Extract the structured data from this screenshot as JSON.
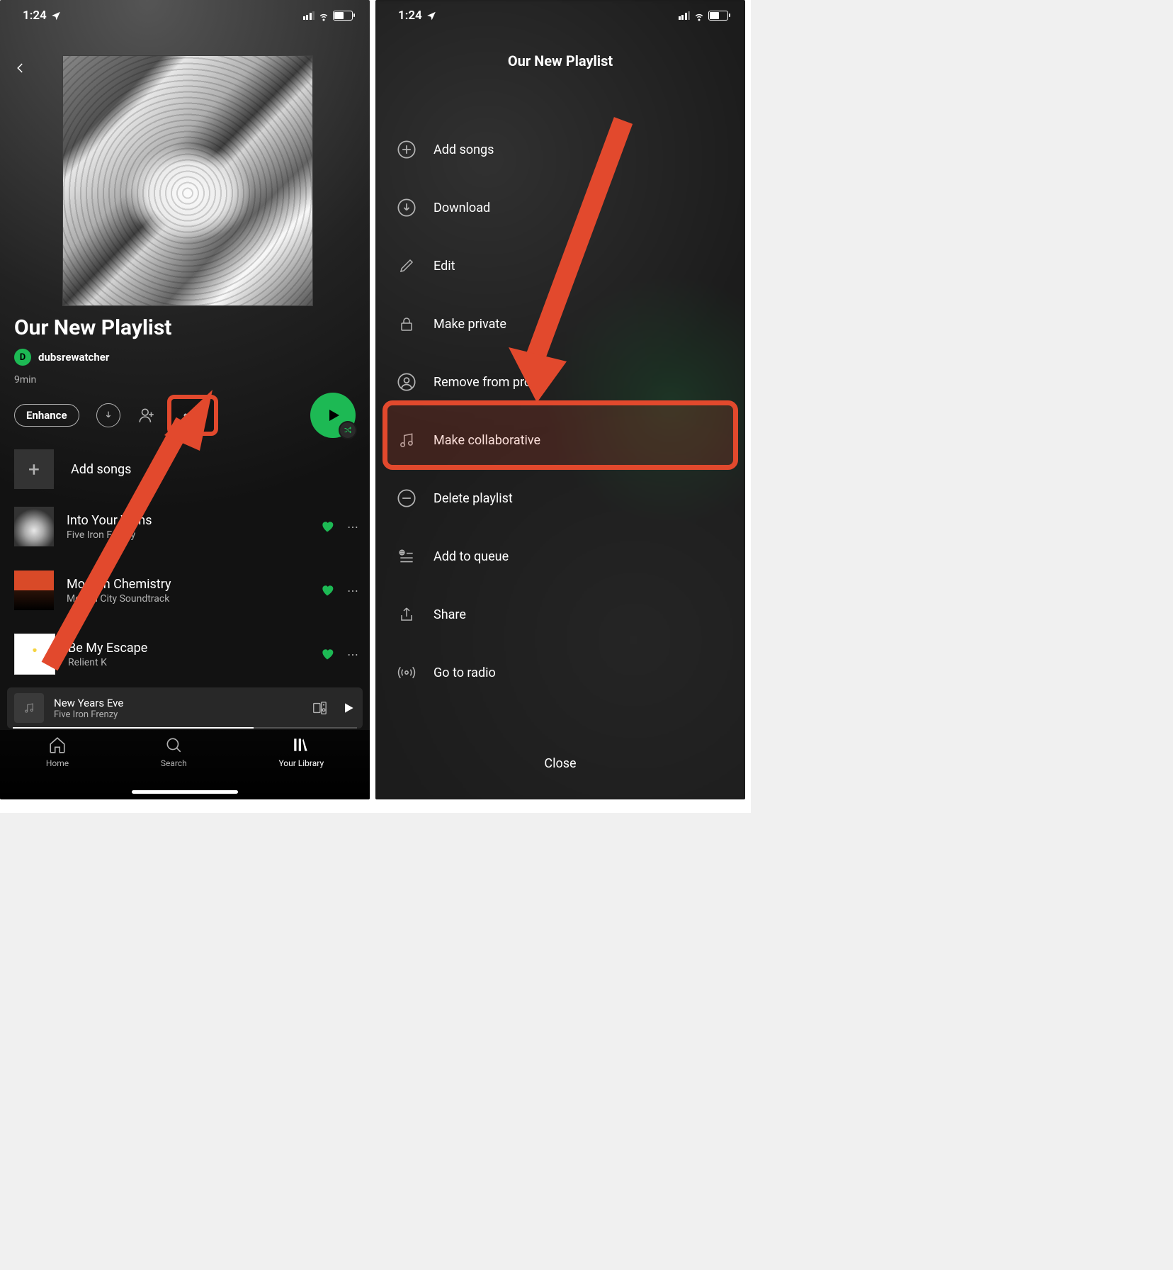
{
  "status": {
    "time": "1:24"
  },
  "left": {
    "playlist_title": "Our New Playlist",
    "owner_initial": "D",
    "owner_name": "dubsrewatcher",
    "duration": "9min",
    "enhance_label": "Enhance",
    "add_songs_label": "Add songs",
    "tracks": [
      {
        "title": "Into Your Veins",
        "artist": "Five Iron Frenzy"
      },
      {
        "title": "Modern Chemistry",
        "artist": "Motion City Soundtrack"
      },
      {
        "title": "Be My Escape",
        "artist": "Relient K"
      }
    ],
    "now_playing": {
      "title": "New Years Eve",
      "artist": "Five Iron Frenzy"
    },
    "nav": {
      "home": "Home",
      "search": "Search",
      "library": "Your Library"
    }
  },
  "right": {
    "title": "Our New Playlist",
    "menu": {
      "add_songs": "Add songs",
      "download": "Download",
      "edit": "Edit",
      "make_private": "Make private",
      "remove_profile": "Remove from profile",
      "make_collab": "Make collaborative",
      "delete": "Delete playlist",
      "add_queue": "Add to queue",
      "share": "Share",
      "go_radio": "Go to radio"
    },
    "close_label": "Close"
  },
  "annotation": {
    "color": "#e2492d"
  }
}
